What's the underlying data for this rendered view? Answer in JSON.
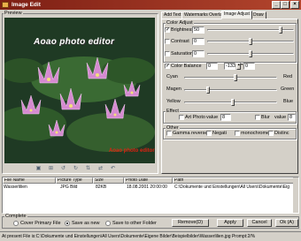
{
  "window": {
    "title": "Image Edit",
    "controls": [
      "_",
      "□",
      "×"
    ]
  },
  "preview": {
    "label": "Preview",
    "watermark_text": "Aoao photo editor",
    "watermark_text2": "Aoao photo editor",
    "toolbar_icons": [
      "fit-icon",
      "zoom-icon",
      "rotate-left-icon",
      "rotate-right-icon",
      "flip-icon",
      "mirror-icon",
      "undo-icon"
    ]
  },
  "tabs": [
    {
      "label": "Add Text"
    },
    {
      "label": "Watermarks Overlay"
    },
    {
      "label": "Image Adjust"
    },
    {
      "label": "Draw"
    }
  ],
  "color_adjust": {
    "label": "Color Adjust",
    "brightness": {
      "label": "Brightness",
      "value": "50",
      "checked": true,
      "level": 0.86
    },
    "contrast": {
      "label": "Contrast",
      "value": "0",
      "checked": false,
      "level": 0.5
    },
    "saturation": {
      "label": "Saturation",
      "value": "0",
      "checked": false,
      "level": 0.5
    }
  },
  "color_balance": {
    "label": "Color Balance",
    "checked": true,
    "v1": "0",
    "v2": "-133",
    "v3": "0",
    "rows": [
      {
        "left": "Cyan",
        "right": "Red",
        "level": 0.55
      },
      {
        "left": "Magen",
        "right": "Green",
        "level": 0.25
      },
      {
        "left": "Yellow",
        "right": "Blue",
        "level": 0.52
      }
    ]
  },
  "effect": {
    "label": "Effect",
    "art_photo": "Art Photo",
    "art_value_label": "value",
    "art_value": "8",
    "blur": "Blur",
    "blur_value_label": "value",
    "blur_value": "8"
  },
  "other": {
    "label": "Other",
    "items": [
      "Gamma reverse",
      "Negati",
      "monochrome",
      "Distinc"
    ]
  },
  "file_table": {
    "headers": [
      "File Name",
      "Picture Type",
      "Size",
      "Photo Date",
      "Path"
    ],
    "rows": [
      [
        "Wasserlilien",
        "JPG Bild",
        "82KB",
        "18.08.2001 20:00:00",
        "C:\\Dokumente und Einstellungen\\All Users\\Dokumente\\Eig"
      ]
    ]
  },
  "complete": {
    "label": "Complete",
    "options": [
      {
        "label": "Cover Primary File",
        "selected": false
      },
      {
        "label": "Save as new",
        "selected": true
      },
      {
        "label": "Save to other Folder",
        "selected": false
      }
    ],
    "buttons": {
      "remove": "Remove(D)",
      "apply": "Apply",
      "cancel": "Cancel",
      "ok": "Ok (A)"
    }
  },
  "status": "At present File is:C:\\Dokumente und Einstellungen\\All Users\\Dokumente\\Eigene Bilder\\Beispielbilder\\Wasserlilien.jpg  Prompt:2/%"
}
